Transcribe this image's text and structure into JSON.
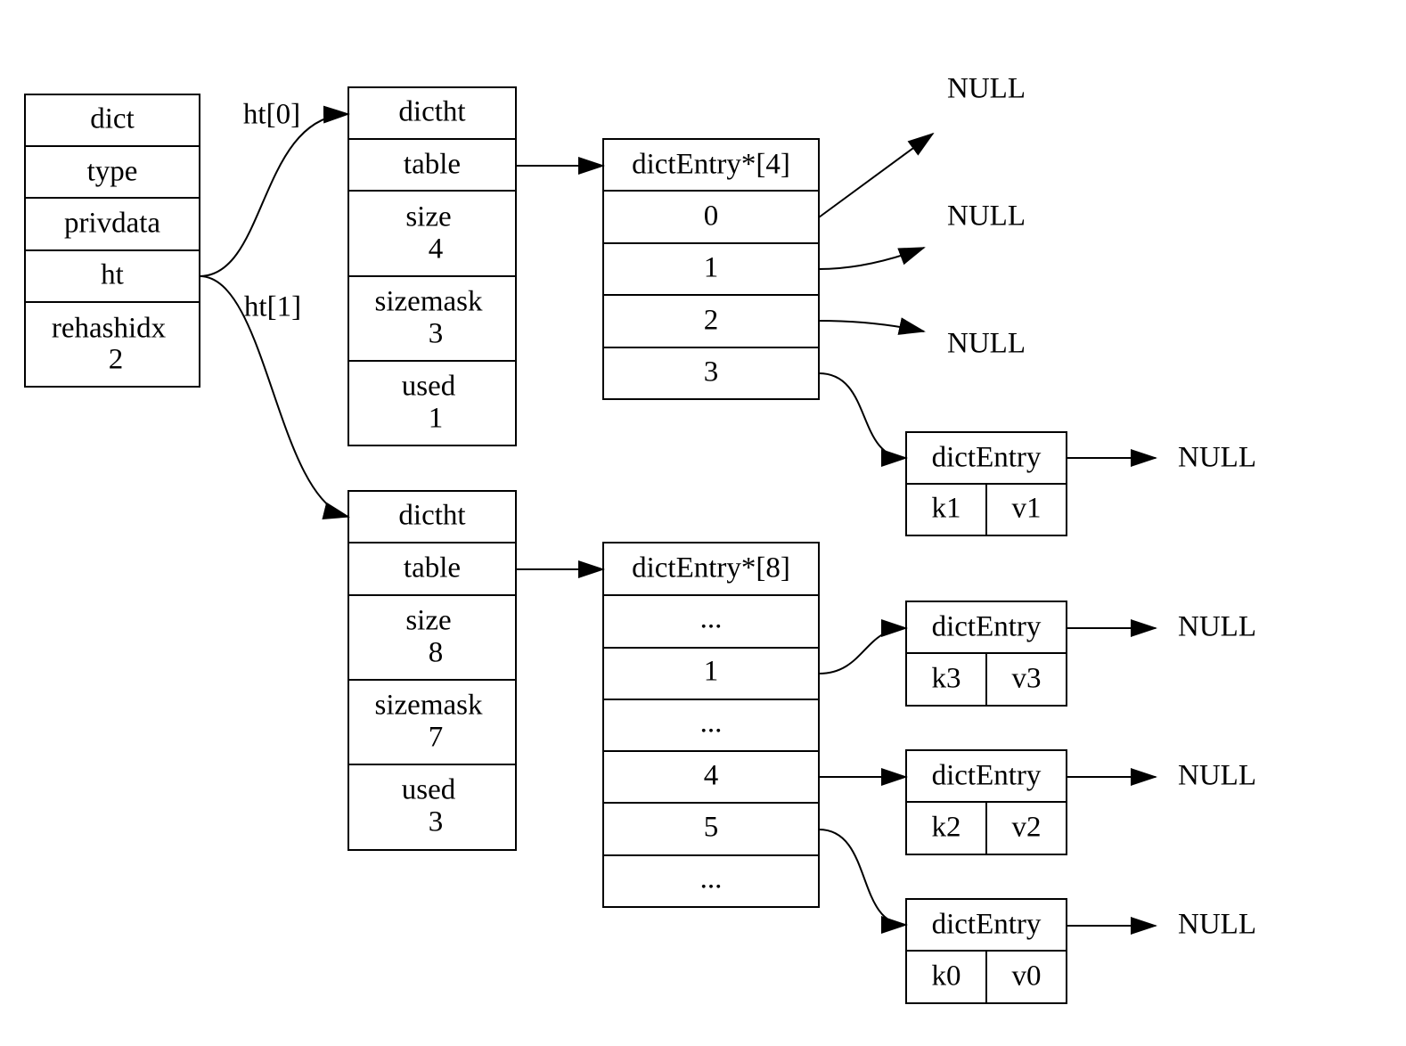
{
  "dict": {
    "fields": [
      "dict",
      "type",
      "privdata",
      "ht",
      "rehashidx"
    ],
    "rehashidx_value": "2"
  },
  "edge_labels": {
    "ht0": "ht[0]",
    "ht1": "ht[1]"
  },
  "ht0": {
    "title": "dictht",
    "table": "table",
    "size": "size",
    "size_value": "4",
    "sizemask": "sizemask",
    "sizemask_value": "3",
    "used": "used",
    "used_value": "1"
  },
  "ht1": {
    "title": "dictht",
    "table": "table",
    "size": "size",
    "size_value": "8",
    "sizemask": "sizemask",
    "sizemask_value": "7",
    "used": "used",
    "used_value": "3"
  },
  "table0": {
    "title": "dictEntry*[4]",
    "slots": [
      "0",
      "1",
      "2",
      "3"
    ]
  },
  "table1": {
    "title": "dictEntry*[8]",
    "slots": [
      "...",
      "1",
      "...",
      "4",
      "5",
      "..."
    ]
  },
  "entries": [
    {
      "title": "dictEntry",
      "key": "k1",
      "value": "v1"
    },
    {
      "title": "dictEntry",
      "key": "k3",
      "value": "v3"
    },
    {
      "title": "dictEntry",
      "key": "k2",
      "value": "v2"
    },
    {
      "title": "dictEntry",
      "key": "k0",
      "value": "v0"
    }
  ],
  "null_label": "NULL",
  "nulls": [
    "NULL",
    "NULL",
    "NULL",
    "NULL",
    "NULL",
    "NULL",
    "NULL"
  ]
}
